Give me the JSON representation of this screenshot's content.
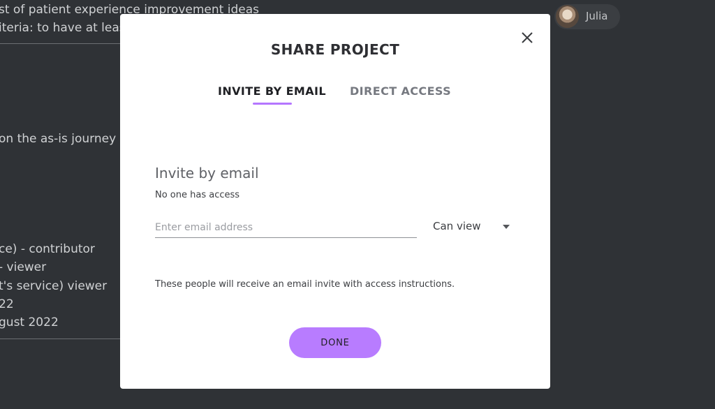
{
  "background": {
    "lines": [
      "st of patient experience improvement ideas",
      "iteria: to have at leas",
      "on the as-is journey",
      "ce) - contributor",
      "- viewer",
      "t's service) viewer",
      "22",
      "gust 2022"
    ]
  },
  "user": {
    "name": "Julia"
  },
  "modal": {
    "title": "SHARE PROJECT",
    "tabs": [
      {
        "label": "INVITE BY EMAIL",
        "active": true
      },
      {
        "label": "DIRECT ACCESS",
        "active": false
      }
    ],
    "section_title": "Invite by email",
    "access_note": "No one has access",
    "email_input": {
      "value": "",
      "placeholder": "Enter email address"
    },
    "permission": {
      "selected": "Can view"
    },
    "info": "These people will receive an email invite with access instructions.",
    "done_label": "DONE"
  },
  "colors": {
    "accent": "#b87cff",
    "overlay": "#2f3236",
    "modal_bg": "#ffffff"
  }
}
